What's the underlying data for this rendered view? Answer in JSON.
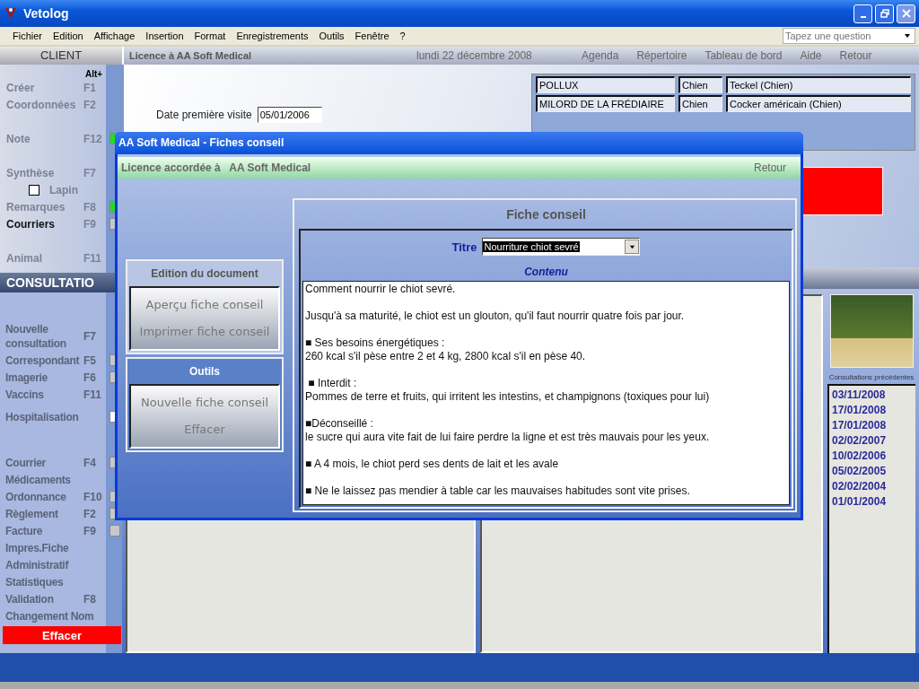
{
  "window": {
    "title": "Vetolog"
  },
  "menu": [
    "Fichier",
    "Edition",
    "Affichage",
    "Insertion",
    "Format",
    "Enregistrements",
    "Outils",
    "Fenêtre",
    "?"
  ],
  "help_search": {
    "placeholder": "Tapez une question"
  },
  "header": {
    "section": "CLIENT",
    "licence": "Licence à  AA Soft Medical",
    "date": "lundi 22 décembre 2008",
    "links": [
      "Agenda",
      "Répertoire",
      "Tableau de bord",
      "Aide",
      "Retour"
    ]
  },
  "sidebar_client": {
    "hint": "Alt+",
    "groups": [
      [
        {
          "kind": "command",
          "label": "Créer",
          "key": "F1",
          "selected": false
        },
        {
          "kind": "command",
          "label": "Coordonnées",
          "key": "F2",
          "selected": false
        }
      ],
      [
        {
          "kind": "command",
          "label": "Note",
          "key": "F12",
          "selected": false,
          "color": "#22dd22"
        }
      ],
      [
        {
          "kind": "command",
          "label": "Synthèse",
          "key": "F7",
          "selected": false
        },
        {
          "kind": "checkbox",
          "label": "Lapin",
          "checked": false
        },
        {
          "kind": "command",
          "label": "Remarques",
          "key": "F8",
          "selected": false,
          "color": "#22dd22"
        },
        {
          "kind": "command",
          "label": "Courriers",
          "key": "F9",
          "selected": true,
          "color": "#c8c8c8"
        }
      ],
      [
        {
          "kind": "command",
          "label": "Animal",
          "key": "F11",
          "selected": false
        }
      ]
    ]
  },
  "sidebar_consultation": {
    "title": "CONSULTATIO",
    "groups": [
      [
        {
          "kind": "command",
          "label": "Nouvelle consultation",
          "key": "F7",
          "selected": false
        },
        {
          "kind": "command",
          "label": "Correspondant",
          "key": "F5",
          "selected": false,
          "color": "#c8c8c8"
        },
        {
          "kind": "command",
          "label": "Imagerie",
          "key": "F6",
          "selected": false,
          "color": "#c8c8c8"
        },
        {
          "kind": "command",
          "label": "Vaccins",
          "key": "F11",
          "selected": false
        }
      ],
      [
        {
          "kind": "command",
          "label": "Hospitalisation",
          "selected": false,
          "color": "#ffffff"
        }
      ],
      [
        {
          "kind": "command",
          "label": "Courrier",
          "key": "F4",
          "selected": false,
          "color": "#c8c8c8"
        },
        {
          "kind": "command",
          "label": "Médicaments",
          "selected": false
        },
        {
          "kind": "command",
          "label": "Ordonnance",
          "key": "F10",
          "selected": false,
          "color": "#c8c8c8"
        },
        {
          "kind": "command",
          "label": "Règlement",
          "key": "F2",
          "selected": false,
          "color": "#c8c8c8"
        },
        {
          "kind": "command",
          "label": "Facture",
          "key": "F9",
          "selected": false,
          "color": "#c8c8c8"
        },
        {
          "kind": "command",
          "label": "Impres.Fiche",
          "selected": false
        },
        {
          "kind": "command",
          "label": "Administratif",
          "selected": false
        },
        {
          "kind": "command",
          "label": "Statistiques",
          "selected": false
        },
        {
          "kind": "command",
          "label": "Validation",
          "key": "F8",
          "selected": false
        },
        {
          "kind": "command",
          "label": "Changement Nom",
          "selected": false
        }
      ]
    ],
    "delete_button": "Effacer"
  },
  "client": {
    "first_visit_label": "Date première visite",
    "first_visit": "05/01/2006",
    "animals": [
      [
        "POLLUX",
        "Chien",
        "Teckel (Chien)"
      ],
      [
        "MILORD DE LA FRÉDIAIRE",
        "Chien",
        "Cocker américain (Chien)"
      ]
    ]
  },
  "history": {
    "caption": "Consultations précédentes",
    "dates": [
      "03/11/2008",
      "17/01/2008",
      "17/01/2008",
      "02/02/2007",
      "10/02/2006",
      "05/02/2005",
      "02/02/2004",
      "01/01/2004"
    ]
  },
  "dialog": {
    "title": "AA Soft Medical - Fiches conseil",
    "licence": "Licence accordée à   AA Soft Medical",
    "back": "Retour",
    "groups": [
      {
        "title": "Edition du document",
        "buttons": [
          "Aperçu fiche conseil",
          "Imprimer fiche conseil"
        ]
      },
      {
        "title": "Outils",
        "buttons": [
          "Nouvelle fiche conseil",
          "Effacer"
        ]
      }
    ],
    "sheet": {
      "title": "Fiche conseil",
      "title_label": "Titre",
      "title_value": "Nourriture chiot sevré",
      "content_label": "Contenu",
      "content": "Comment nourrir le chiot sevré.\n\nJusqu'à sa maturité, le chiot est un glouton, qu'il faut nourrir quatre fois par jour.\n\n■ Ses besoins énergétiques :\n260 kcal s'il pèse entre 2 et 4 kg, 2800 kcal s'il en pèse 40.\n\n ■ Interdit :\nPommes de terre et fruits, qui irritent les intestins, et champignons (toxiques pour lui)\n\n■Déconseillé :\nle sucre qui aura vite fait de lui faire perdre la ligne et est très mauvais pour les yeux.\n\n■ A 4 mois, le chiot perd ses dents de lait et les avale\n\n■ Ne le laissez pas mendier à table car les mauvaises habitudes sont vite prises."
    }
  }
}
